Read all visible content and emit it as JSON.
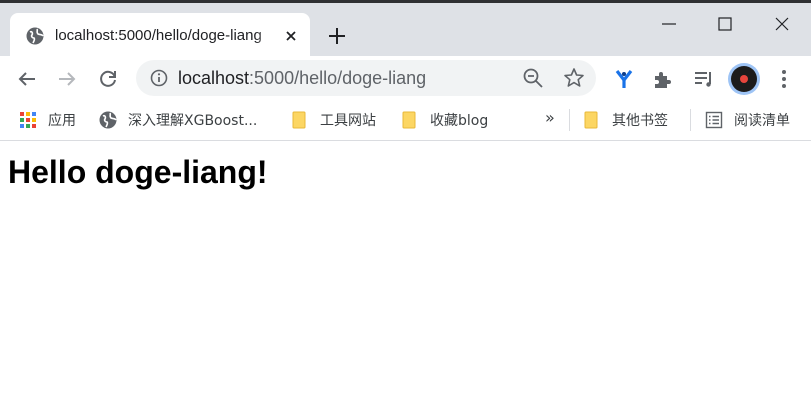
{
  "tab": {
    "title": "localhost:5000/hello/doge-liang",
    "favicon": "globe-icon"
  },
  "window_controls": [
    "minimize-icon",
    "maximize-icon",
    "close-icon"
  ],
  "omnibox": {
    "host": "localhost",
    "rest": ":5000/hello/doge-liang"
  },
  "bookmarks": {
    "apps_label": "应用",
    "items": [
      {
        "label": "深入理解XGBoost...",
        "icon": "globe-icon"
      },
      {
        "label": "工具网站",
        "icon": "folder-icon"
      },
      {
        "label": "收藏blog",
        "icon": "folder-icon"
      }
    ],
    "more_label": "»",
    "other_label": "其他书签",
    "reading_list_label": "阅读清单"
  },
  "page": {
    "heading": "Hello doge-liang!"
  },
  "colors": {
    "tabstrip": "#dee1e6",
    "omnibox": "#f1f3f4",
    "folder": "#fcd663",
    "avatar_ring": "#9ec4f5"
  }
}
